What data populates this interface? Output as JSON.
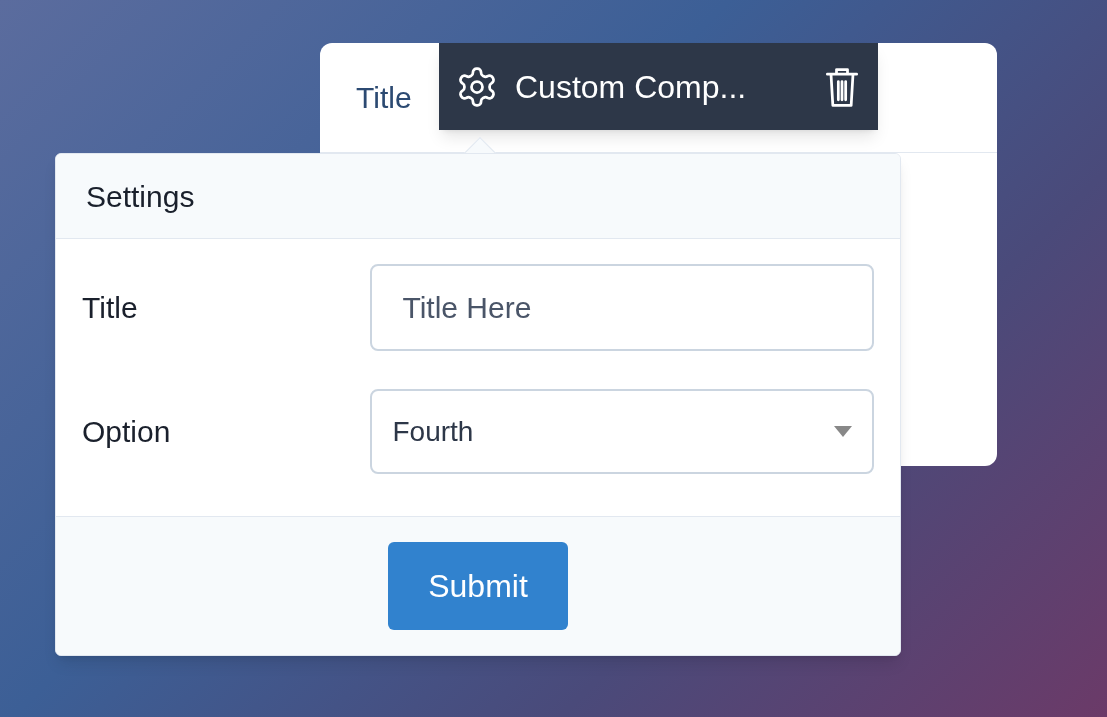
{
  "card": {
    "title": "Title"
  },
  "toolbar": {
    "label": "Custom Comp..."
  },
  "settings": {
    "title": "Settings",
    "fields": [
      {
        "kind": "text",
        "label": "Title",
        "value": "Title Here"
      },
      {
        "kind": "select",
        "label": "Option",
        "value": "Fourth"
      }
    ],
    "submit": "Submit"
  }
}
